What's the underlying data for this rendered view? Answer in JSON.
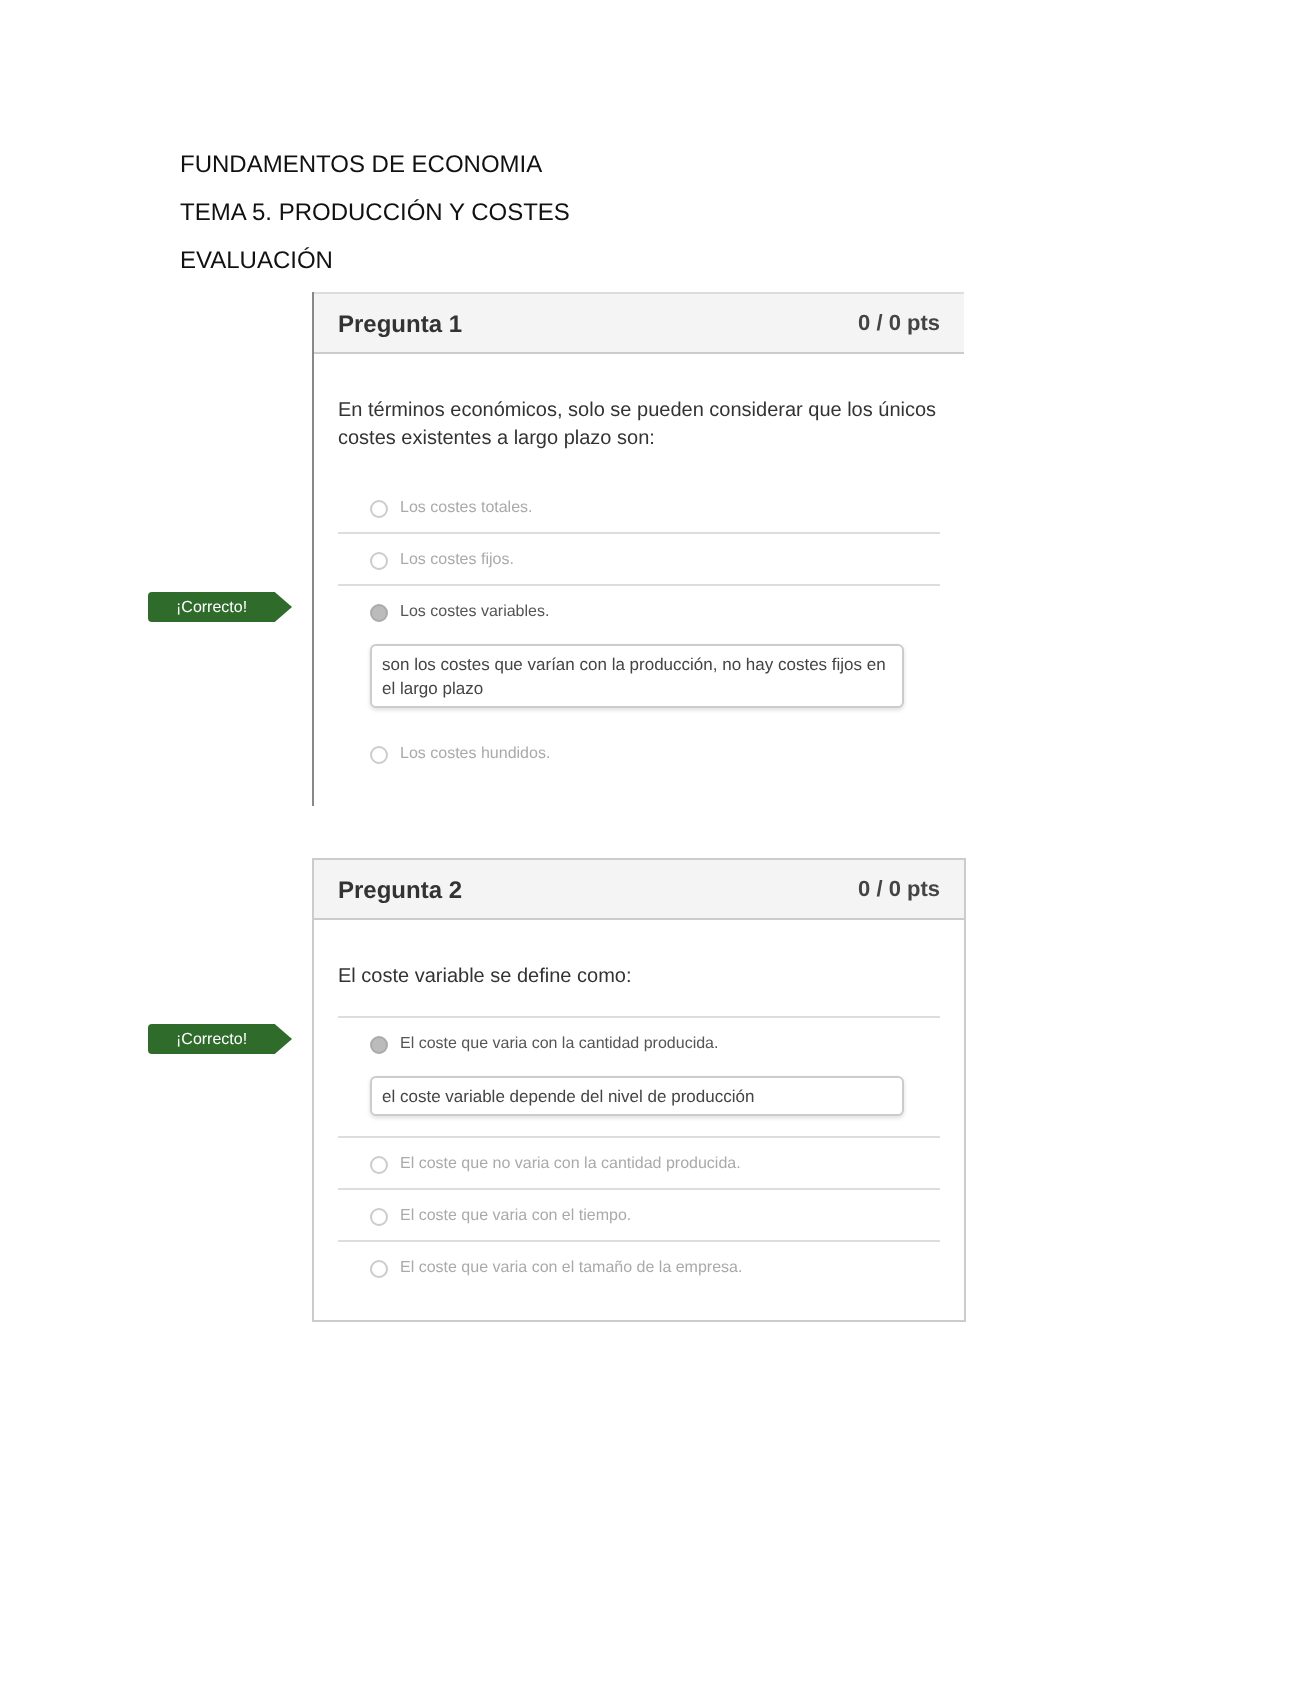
{
  "headings": [
    "FUNDAMENTOS DE ECONOMIA",
    "TEMA 5. PRODUCCIÓN Y COSTES",
    "EVALUACIÓN"
  ],
  "questions": [
    {
      "title": "Pregunta 1",
      "points": "0 / 0 pts",
      "cropped": true,
      "text": "En términos económicos, solo se pueden considerar que los únicos costes existentes a largo plazo son:",
      "badge": "¡Correcto!",
      "divider_after_text": false,
      "options": [
        {
          "label": "Los costes totales.",
          "selected": false,
          "divider": true
        },
        {
          "label": "Los costes fijos.",
          "selected": false,
          "divider": true
        },
        {
          "label": "Los costes variables.",
          "selected": true,
          "comment": "son los costes que varían con la producción, no hay costes fijos en el largo plazo",
          "divider": false
        },
        {
          "label": "Los costes hundidos.",
          "selected": false,
          "divider": false
        }
      ]
    },
    {
      "title": "Pregunta 2",
      "points": "0 / 0 pts",
      "cropped": false,
      "text": "El coste variable se define como:",
      "badge": "¡Correcto!",
      "divider_after_text": true,
      "options": [
        {
          "label": "El coste que varia con la cantidad producida.",
          "selected": true,
          "comment": "el coste variable depende del nivel de producción",
          "divider": true
        },
        {
          "label": "El coste que no varia con la cantidad producida.",
          "selected": false,
          "divider": true
        },
        {
          "label": "El coste que varia con el tiempo.",
          "selected": false,
          "divider": true
        },
        {
          "label": "El coste que varia con el tamaño de la empresa.",
          "selected": false,
          "divider": false
        }
      ]
    }
  ]
}
